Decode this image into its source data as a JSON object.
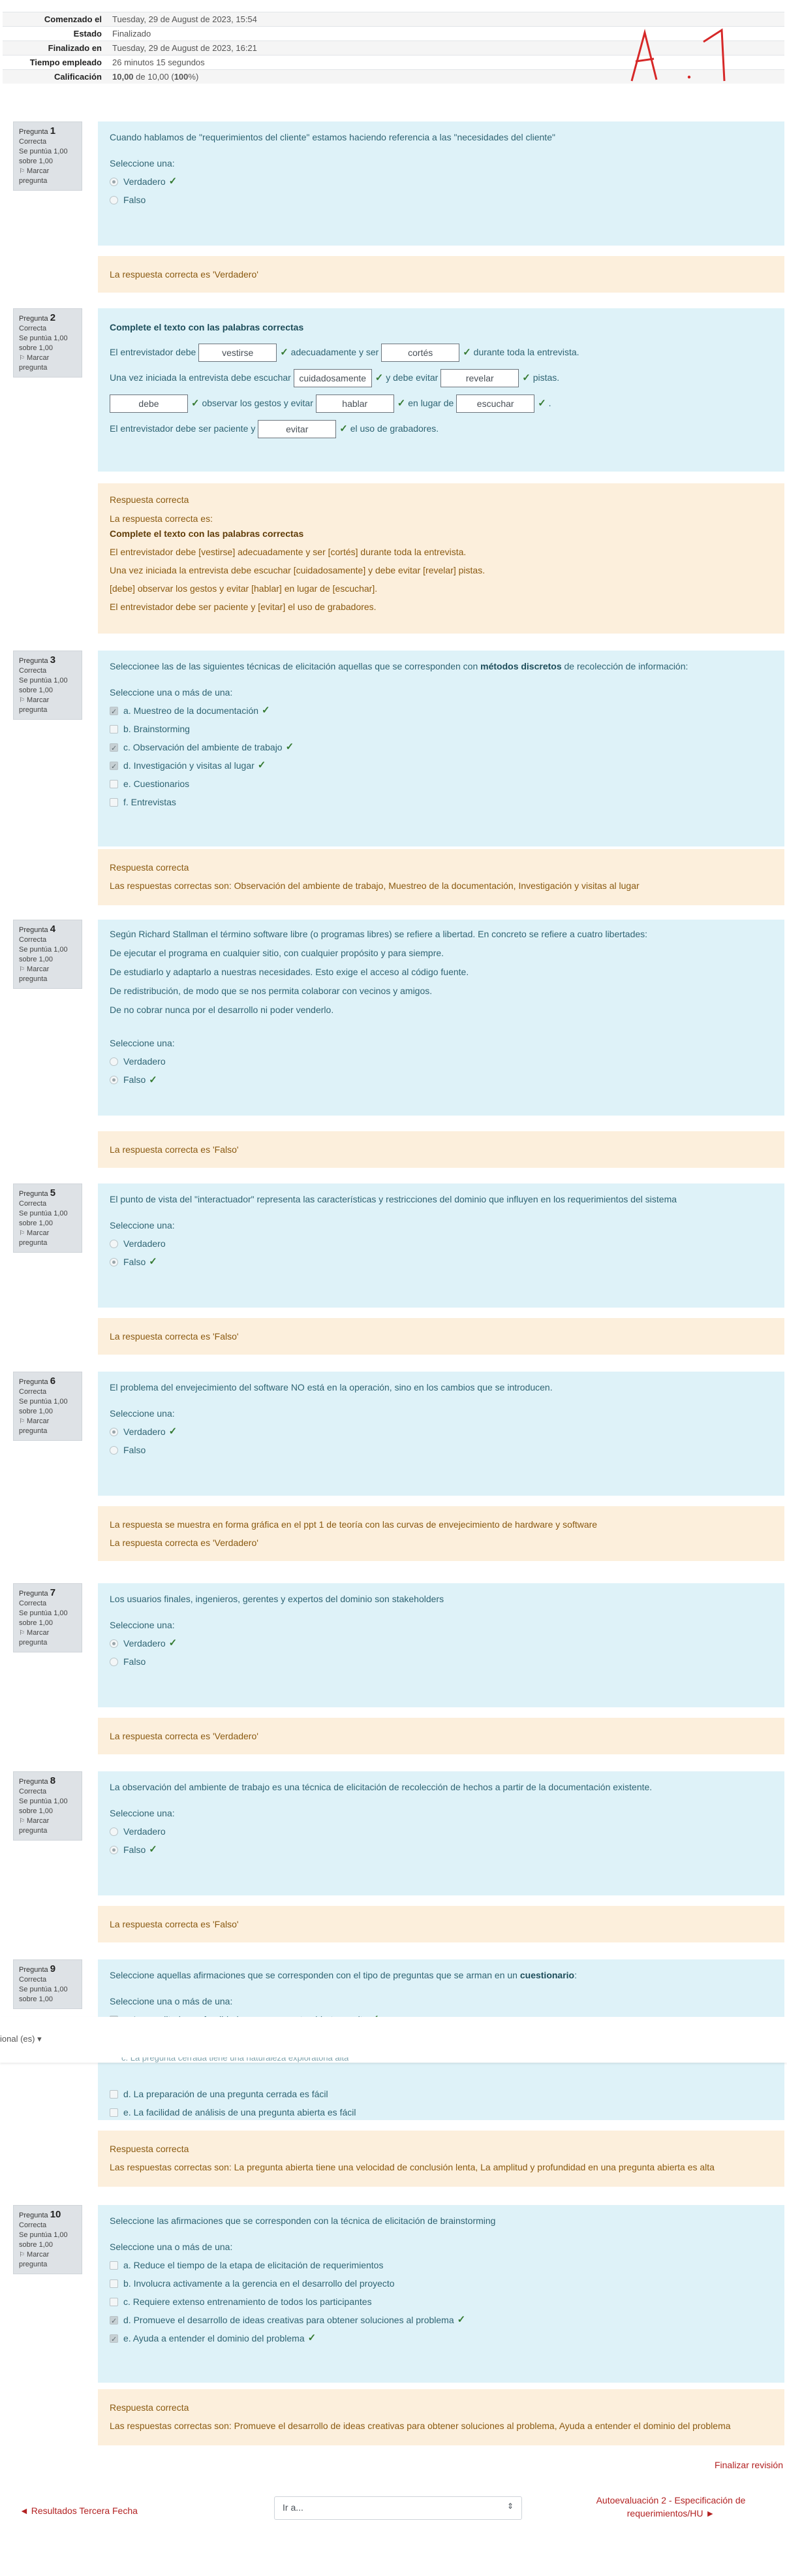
{
  "summary": [
    {
      "k": "Comenzado el",
      "v": "Tuesday, 29 de August de 2023, 15:54"
    },
    {
      "k": "Estado",
      "v": "Finalizado"
    },
    {
      "k": "Finalizado en",
      "v": "Tuesday, 29 de August de 2023, 16:21"
    },
    {
      "k": "Tiempo empleado",
      "v": "26 minutos 15 segundos"
    },
    {
      "k": "Calificación",
      "v_bold": "10,00",
      "v_mid": " de 10,00 (",
      "v_pct": "100",
      "v_end": "%)"
    }
  ],
  "qinfo": {
    "label": "Pregunta",
    "state": "Correcta",
    "grade": "Se puntúa 1,00 sobre 1,00",
    "flag": "Marcar pregunta"
  },
  "prompts": {
    "one": "Seleccione una:",
    "many": "Seleccione una o más de una:"
  },
  "q1": {
    "text": "Cuando hablamos de \"requerimientos del cliente\" estamos haciendo referencia a las \"necesidades del cliente\"",
    "options": [
      "Verdadero",
      "Falso"
    ],
    "feedback": "La respuesta correcta es 'Verdadero'"
  },
  "q2": {
    "title": "Complete el texto con las palabras correctas",
    "l1a": "El entrevistador debe",
    "in1": "vestirse",
    "l1b": "adecuadamente y ser",
    "in2": "cortés",
    "l1c": "durante toda la entrevista.",
    "l2a": "Una vez iniciada la entrevista debe escuchar",
    "in3": "cuidadosamente",
    "l2b": "y debe evitar",
    "in4": "revelar",
    "l2c": "pistas.",
    "in5": "debe",
    "l3b": "observar los gestos y evitar",
    "in6": "hablar",
    "l3c": "en lugar de",
    "in7": "escuchar",
    "l3d": ".",
    "l4a": "El entrevistador debe ser paciente y",
    "in8": "evitar",
    "l4b": "el uso de grabadores.",
    "fb_head": "Respuesta correcta",
    "fb_intro": "La respuesta correcta es:",
    "fb_title": "Complete el texto con las palabras correctas",
    "fb_lines": [
      "El entrevistador debe [vestirse] adecuadamente y ser [cortés] durante toda la entrevista.",
      "Una vez iniciada la entrevista debe escuchar [cuidadosamente] y debe evitar [revelar] pistas.",
      "[debe] observar los gestos y evitar [hablar] en lugar de [escuchar].",
      "El entrevistador debe ser paciente y [evitar] el uso de grabadores."
    ]
  },
  "q3": {
    "text_a": "Seleccionee las de las siguientes técnicas de elicitación aquellas que se corresponden con ",
    "text_b": "métodos discretos",
    "text_c": " de recolección de información:",
    "options": [
      "a. Muestreo de la documentación",
      "b. Brainstorming",
      "c. Observación del ambiente de trabajo",
      "d. Investigación y visitas al lugar",
      "e. Cuestionarios",
      "f. Entrevistas"
    ],
    "fb_head": "Respuesta correcta",
    "fb": "Las respuestas correctas son: Observación del ambiente de trabajo, Muestreo de la documentación, Investigación y visitas al lugar"
  },
  "q4": {
    "lines": [
      "Según Richard Stallman el término software libre (o programas libres) se refiere a libertad. En concreto se refiere a cuatro libertades:",
      "De ejecutar el programa en cualquier sitio, con cualquier propósito y para siempre.",
      "De estudiarlo y adaptarlo a nuestras necesidades. Esto exige el acceso al código fuente.",
      "De redistribución, de modo que se nos permita colaborar con vecinos y amigos.",
      "De no cobrar nunca por el desarrollo ni poder venderlo."
    ],
    "options": [
      "Verdadero",
      "Falso"
    ],
    "feedback": "La respuesta correcta es 'Falso'"
  },
  "q5": {
    "text": "El punto de vista del \"interactuador\" representa las características y restricciones del dominio que influyen en los requerimientos del sistema",
    "options": [
      "Verdadero",
      "Falso"
    ],
    "feedback": "La respuesta correcta es 'Falso'"
  },
  "q6": {
    "text": "El problema del envejecimiento del software NO está en la operación, sino en los cambios que se introducen.",
    "options": [
      "Verdadero",
      "Falso"
    ],
    "fb1": "La respuesta se muestra en forma gráfica en el ppt 1 de teoría con las curvas de envejecimiento de hardware y software",
    "fb2": "La respuesta correcta es 'Verdadero'"
  },
  "q7": {
    "text": "Los usuarios finales,  ingenieros, gerentes y expertos del dominio son stakeholders",
    "options": [
      "Verdadero",
      "Falso"
    ],
    "feedback": "La respuesta correcta es 'Verdadero'"
  },
  "q8": {
    "text": "La observación del ambiente de trabajo es una técnica de elicitación de recolección de hechos a partir de la documentación existente.",
    "options": [
      "Verdadero",
      "Falso"
    ],
    "feedback": "La respuesta correcta es 'Falso'"
  },
  "q9": {
    "text_a": "Seleccione aquellas afirmaciones que se corresponden con el tipo de preguntas  que se arman en un ",
    "text_b": "cuestionario",
    "text_c": ":",
    "options": [
      "a. La amplitud y profundidad en una pregunta abierta es alta",
      "c. La pregunta cerrada tiene una naturaleza exploratoria alta",
      "d. La preparación de una pregunta cerrada es fácil",
      "e. La facilidad de análisis de una pregunta abierta es fácil"
    ],
    "fb_head": "Respuesta correcta",
    "fb": "Las respuestas correctas son: La pregunta abierta tiene una velocidad de conclusión lenta, La amplitud y profundidad en una pregunta abierta es alta"
  },
  "q10": {
    "text": "Seleccione las afirmaciones que se corresponden con la técnica de elicitación de brainstorming",
    "options": [
      "a. Reduce el tiempo de la etapa de elicitación de requerimientos",
      "b. Involucra activamente a la gerencia en el desarrollo del proyecto",
      "c. Requiere extenso entrenamiento de todos los participantes",
      "d. Promueve el desarrollo de ideas creativas para obtener soluciones al problema",
      "e. Ayuda a entender el dominio del problema"
    ],
    "fb_head": "Respuesta correcta",
    "fb": "Las respuestas correctas son: Promueve el desarrollo de ideas creativas para obtener soluciones al problema, Ayuda a entender el dominio del problema"
  },
  "overlay": {
    "lang": "ional (es) ▾"
  },
  "nav": {
    "finish": "Finalizar revisión",
    "prev": "◄ Resultados Tercera Fecha",
    "jump": "Ir a...",
    "next": "Autoevaluación 2 - Especificación de requerimientos/HU ►"
  }
}
